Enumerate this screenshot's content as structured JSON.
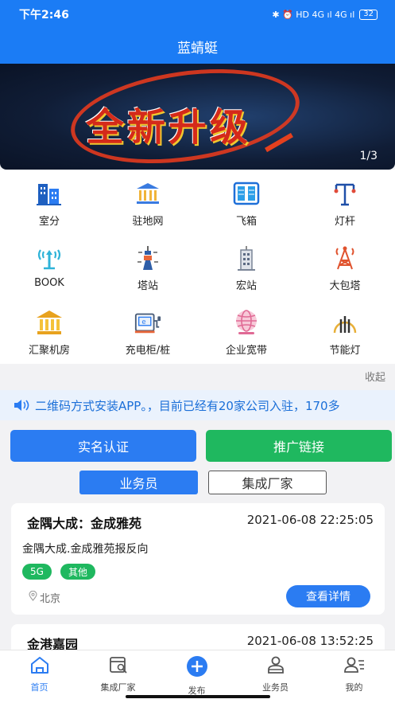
{
  "status_bar": {
    "time": "下午2:46",
    "indicators": "✱ ⏰ HD 4G ıl 4G ıl",
    "battery": "32"
  },
  "nav": {
    "title": "蓝蜻蜓"
  },
  "banner": {
    "text": "全新升级",
    "pager": "1/3"
  },
  "categories": [
    {
      "label": "室分",
      "icon": "building-icon"
    },
    {
      "label": "驻地网",
      "icon": "bank-icon"
    },
    {
      "label": "飞箱",
      "icon": "cabinet-icon"
    },
    {
      "label": "灯杆",
      "icon": "lamp-pole-icon"
    },
    {
      "label": "BOOK",
      "icon": "antenna-signal-icon"
    },
    {
      "label": "塔站",
      "icon": "tower-station-icon"
    },
    {
      "label": "宏站",
      "icon": "macro-station-icon"
    },
    {
      "label": "大包塔",
      "icon": "lattice-tower-icon"
    },
    {
      "label": "汇聚机房",
      "icon": "temple-icon"
    },
    {
      "label": "充电柜/桩",
      "icon": "charging-pile-icon"
    },
    {
      "label": "企业宽带",
      "icon": "globe-icon"
    },
    {
      "label": "节能灯",
      "icon": "energy-lamp-icon"
    }
  ],
  "collapse_label": "收起",
  "notice": {
    "text": "二维码方式安装APP。，目前已经有20家公司入驻，170多"
  },
  "actions": {
    "verify": "实名认证",
    "promote": "推广链接"
  },
  "segments": {
    "active": "业务员",
    "inactive": "集成厂家"
  },
  "posts": [
    {
      "title": "金隅大成：金成雅苑",
      "time": "2021-06-08 22:25:05",
      "desc": "金隅大成.金成雅苑报反向",
      "tags": [
        "5G",
        "其他"
      ],
      "location": "北京",
      "detail": "查看详情"
    },
    {
      "title": "金港嘉园",
      "time": "2021-06-08 13:52:25"
    }
  ],
  "tabs": [
    {
      "label": "首页",
      "icon": "home-icon"
    },
    {
      "label": "集成厂家",
      "icon": "vendor-icon"
    },
    {
      "label": "发布",
      "icon": "plus-icon"
    },
    {
      "label": "业务员",
      "icon": "staff-icon"
    },
    {
      "label": "我的",
      "icon": "profile-icon"
    }
  ],
  "colors": {
    "primary": "#1b7cf5",
    "green": "#1fb85f"
  }
}
